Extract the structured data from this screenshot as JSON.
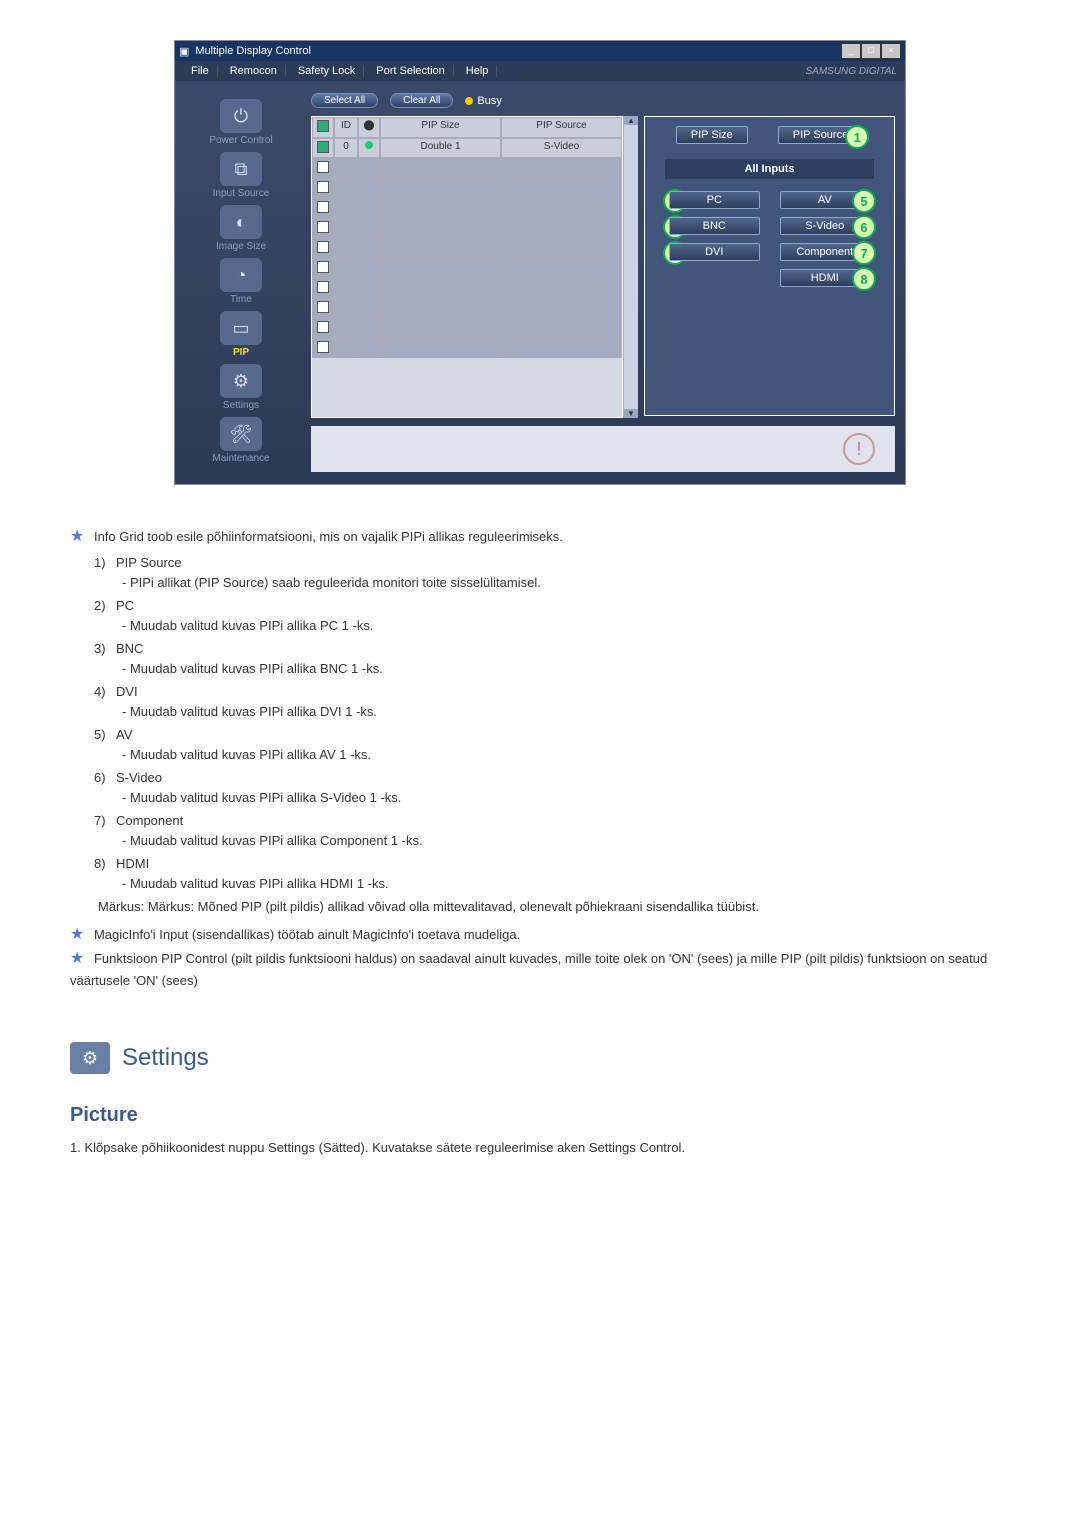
{
  "window": {
    "title": "Multiple Display Control",
    "brand": "SAMSUNG DIGITAL"
  },
  "menu": {
    "file": "File",
    "remocon": "Remocon",
    "safety_lock": "Safety Lock",
    "port_selection": "Port Selection",
    "help": "Help"
  },
  "sidebar": {
    "items": [
      {
        "label": "Power Control"
      },
      {
        "label": "Input Source"
      },
      {
        "label": "Image Size"
      },
      {
        "label": "Time"
      },
      {
        "label": "PIP"
      },
      {
        "label": "Settings"
      },
      {
        "label": "Maintenance"
      }
    ]
  },
  "toolbar": {
    "select_all": "Select All",
    "clear_all": "Clear All",
    "busy": "Busy"
  },
  "grid": {
    "headers": {
      "chk": "",
      "id": "ID",
      "status": "",
      "pip_size": "PIP Size",
      "pip_source": "PIP Source"
    },
    "row0": {
      "id": "0",
      "pip_size": "Double 1",
      "pip_source": "S-Video"
    }
  },
  "right": {
    "pip_size": "PIP Size",
    "pip_source": "PIP Source",
    "all_inputs": "All Inputs",
    "pc": "PC",
    "av": "AV",
    "bnc": "BNC",
    "svideo": "S-Video",
    "dvi": "DVI",
    "component": "Component",
    "hdmi": "HDMI",
    "n1": "1",
    "n2": "2",
    "n3": "3",
    "n4": "4",
    "n5": "5",
    "n6": "6",
    "n7": "7",
    "n8": "8"
  },
  "doc": {
    "intro": "Info Grid toob esile põhiinformatsiooni, mis on vajalik PIPi allikas reguleerimiseks.",
    "items": [
      {
        "n": "1)",
        "t": "PIP Source",
        "d": "- PIPi allikat (PIP Source) saab reguleerida monitori toite sisselülitamisel."
      },
      {
        "n": "2)",
        "t": "PC",
        "d": "- Muudab valitud kuvas PIPi allika PC 1 -ks."
      },
      {
        "n": "3)",
        "t": "BNC",
        "d": "- Muudab valitud kuvas PIPi allika BNC 1 -ks."
      },
      {
        "n": "4)",
        "t": "DVI",
        "d": "- Muudab valitud kuvas PIPi allika DVI 1 -ks."
      },
      {
        "n": "5)",
        "t": "AV",
        "d": "- Muudab valitud kuvas PIPi allika AV 1 -ks."
      },
      {
        "n": "6)",
        "t": "S-Video",
        "d": "- Muudab valitud kuvas PIPi allika S-Video 1 -ks."
      },
      {
        "n": "7)",
        "t": "Component",
        "d": "- Muudab valitud kuvas PIPi allika Component 1 -ks."
      },
      {
        "n": "8)",
        "t": "HDMI",
        "d": "- Muudab valitud kuvas PIPi allika HDMI 1 -ks."
      }
    ],
    "markus": "Märkus: Märkus: Mõned PIP (pilt pildis) allikad võivad olla mittevalitavad, olenevalt põhiekraani sisendallika tüübist.",
    "star2": "MagicInfo'i Input (sisendallikas) töötab ainult MagicInfo'i toetava mudeliga.",
    "star3": "Funktsioon PIP Control (pilt pildis funktsiooni haldus) on saadaval ainult kuvades, mille toite olek on 'ON' (sees) ja mille PIP (pilt pildis) funktsioon on seatud väärtusele 'ON' (sees)",
    "settings_head": "Settings",
    "picture_head": "Picture",
    "picture_step": "1.  Klõpsake põhiikoonidest nuppu Settings (Sätted). Kuvatakse sätete reguleerimise aken Settings Control."
  }
}
